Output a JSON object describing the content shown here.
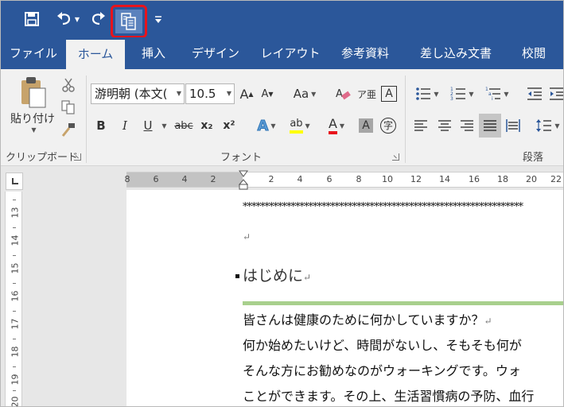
{
  "tabs": [
    {
      "label": "ファイル",
      "active": false
    },
    {
      "label": "ホーム",
      "active": true
    },
    {
      "label": "挿入",
      "active": false
    },
    {
      "label": "デザイン",
      "active": false
    },
    {
      "label": "レイアウト",
      "active": false
    },
    {
      "label": "参考資料",
      "active": false
    },
    {
      "label": "差し込み文書",
      "active": false
    },
    {
      "label": "校閲",
      "active": false
    }
  ],
  "ribbon": {
    "clipboard": {
      "paste_label": "貼り付け",
      "group_label": "クリップボード"
    },
    "font": {
      "font_name": "游明朝 (本文(",
      "font_size": "10.5",
      "case_label": "Aa",
      "strikethrough_label": "abc",
      "subscript_label": "x₂",
      "superscript_label": "x²",
      "bold_label": "B",
      "italic_label": "I",
      "underline_label": "U",
      "group_label": "フォント"
    },
    "paragraph": {
      "group_label": "段落"
    }
  },
  "ruler": {
    "numbers": [
      "8",
      "6",
      "4",
      "2",
      "2",
      "4",
      "6",
      "8",
      "10",
      "12",
      "14",
      "16",
      "18",
      "20",
      "22"
    ],
    "vertical_numbers": [
      "13",
      "14",
      "15",
      "16",
      "17",
      "18",
      "19",
      "20"
    ]
  },
  "document": {
    "asterisks": "****************************************************************",
    "heading": "はじめに",
    "lines": [
      "皆さんは健康のために何かしていますか？",
      "何か始めたいけど、時間がないし、そもそも何が",
      "そんな方にお勧めなのがウォーキングです。ウォ",
      "ことができます。その上、生活習慣病の予防、血行"
    ],
    "pilcrow": "↵"
  },
  "colors": {
    "title_bar": "#2b579a",
    "highlight_border": "#e8141c",
    "ribbon": "#f1f1f1",
    "heading_rule": "#a8d08d"
  }
}
